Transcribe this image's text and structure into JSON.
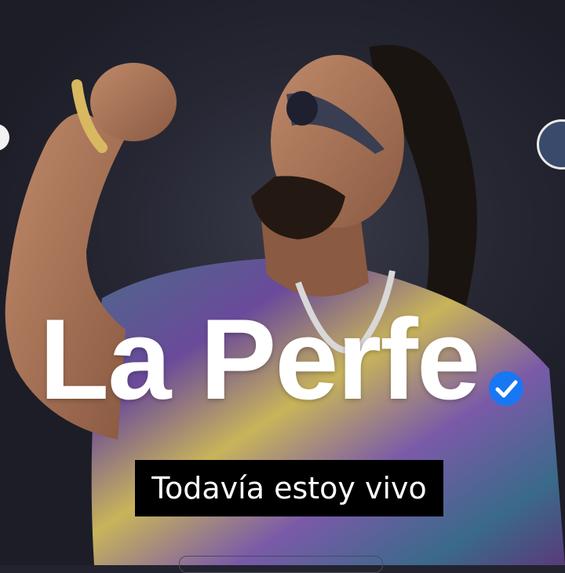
{
  "profile": {
    "name": "La Perfe",
    "caption": "Todavía estoy vivo",
    "verified": true,
    "verified_color": "#1877f2"
  },
  "icons": {
    "left_edge": "share-icon",
    "right_edge": "avatar-thumbnail",
    "badge": "verified-check-icon"
  },
  "colors": {
    "background": "#22232e",
    "caption_bg": "#000000",
    "title_text": "#ffffff"
  }
}
